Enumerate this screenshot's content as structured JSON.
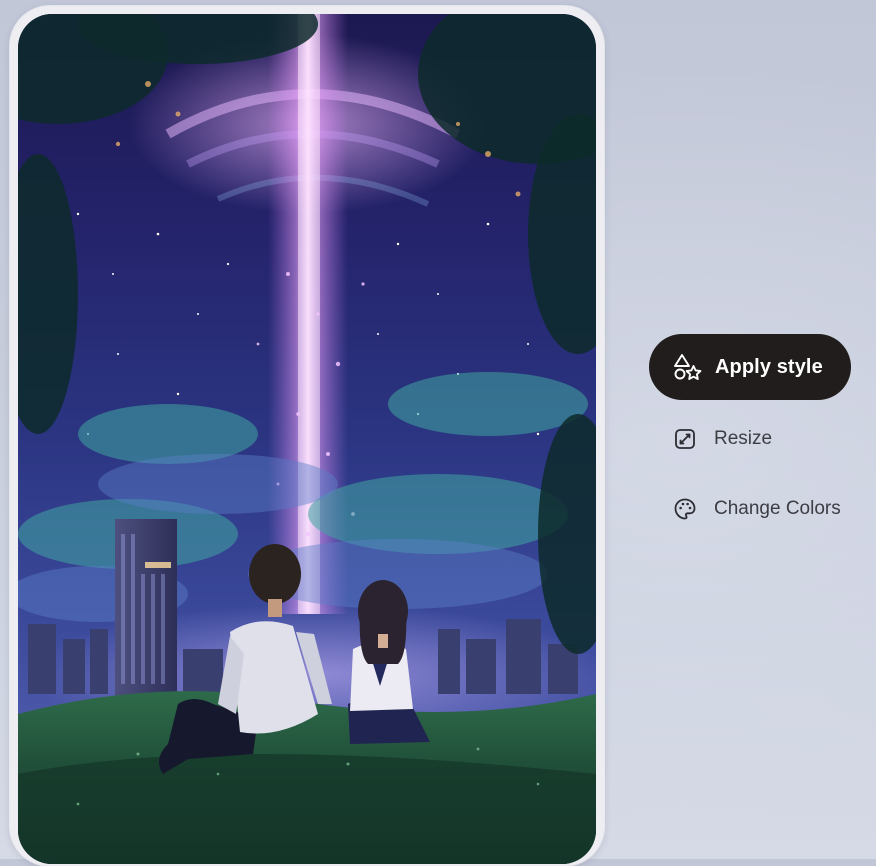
{
  "image_card": {
    "description_icon": "artwork-image",
    "alt": "Anime-style illustration of two people sitting on a grassy hill looking up at a glowing violet light beam in a starry night sky above a city skyline"
  },
  "actions": {
    "apply_style": {
      "label": "Apply style",
      "icon": "shapes-icon"
    },
    "resize": {
      "label": "Resize",
      "icon": "resize-icon"
    },
    "change_colors": {
      "label": "Change Colors",
      "icon": "palette-icon"
    }
  },
  "colors": {
    "apply_button_bg": "#201d1c",
    "apply_button_text": "#ffffff",
    "secondary_text": "#3d3d44",
    "panel_bg": "#c7ccdb"
  }
}
